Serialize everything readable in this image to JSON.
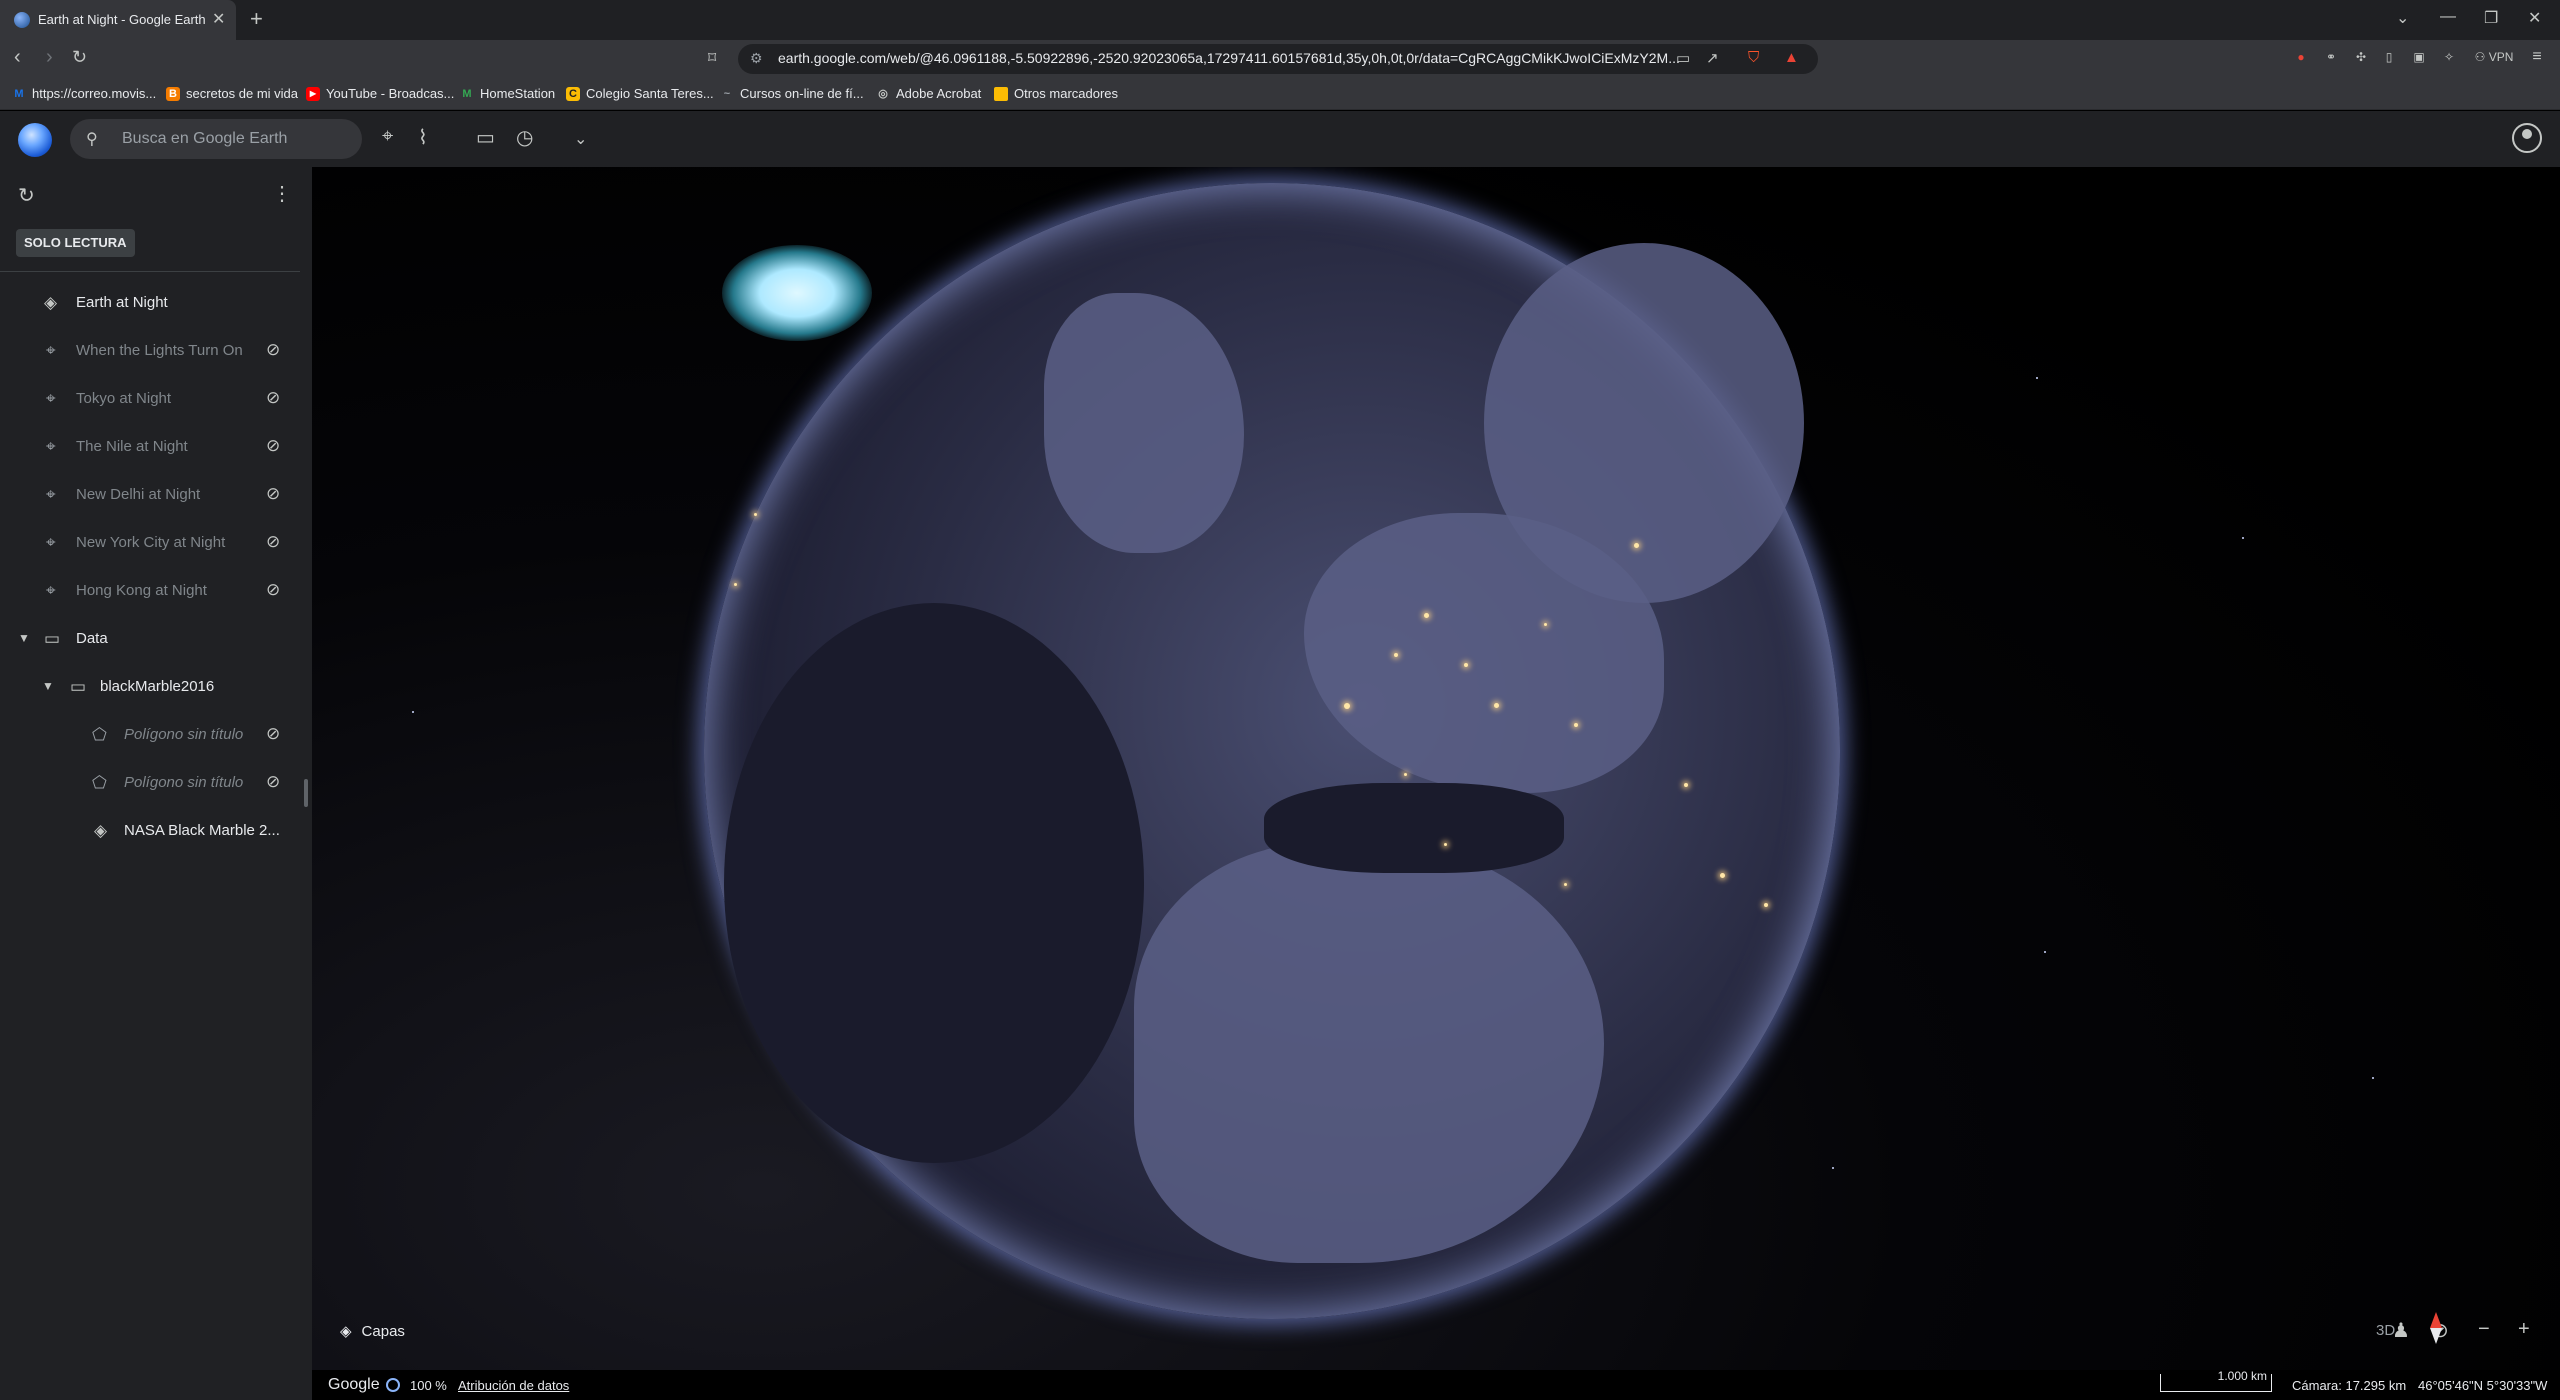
{
  "browser": {
    "tab_title": "Earth at Night - Google Earth",
    "url": "earth.google.com/web/@46.0961188,-5.50922896,-2520.92023065a,17297411.60157681d,35y,0h,0t,0r/data=CgRCAggCMikKJwoICiExMzY2M...",
    "bookmarks": [
      {
        "label": "https://correo.movis...",
        "color": "#1a73e8",
        "glyph": "M"
      },
      {
        "label": "secretos de mi vida",
        "color": "#f57c00",
        "glyph": "B"
      },
      {
        "label": "YouTube - Broadcas...",
        "color": "#ff0000",
        "glyph": "▶"
      },
      {
        "label": "HomeStation",
        "color": "#34a853",
        "glyph": "M"
      },
      {
        "label": "Colegio Santa Teres...",
        "color": "#fbbc04",
        "glyph": "C"
      },
      {
        "label": "Cursos on-line de fí...",
        "color": "#5f6368",
        "glyph": "~"
      },
      {
        "label": "Adobe Acrobat",
        "color": "#5f6368",
        "glyph": "◎"
      },
      {
        "label": "Otros marcadores",
        "color": "#fbbc04",
        "glyph": "▭"
      }
    ],
    "vpn_label": "VPN"
  },
  "earth": {
    "search_placeholder": "Busca en Google Earth",
    "readonly_badge": "SOLO LECTURA",
    "project_title": "Earth at Night",
    "places": [
      "When the Lights Turn On",
      "Tokyo at Night",
      "The Nile at Night",
      "New Delhi at Night",
      "New York City at Night",
      "Hong Kong at Night"
    ],
    "folder_data": "Data",
    "folder_black_marble": "blackMarble2016",
    "polygons": [
      "Polígono sin título",
      "Polígono sin título"
    ],
    "layer_nasa": "NASA Black Marble 2...",
    "layers_button": "Capas",
    "view_3d": "3D"
  },
  "footer": {
    "google": "Google",
    "percent": "100 %",
    "attribution": "Atribución de datos",
    "scale": "1.000 km",
    "camera": "Cámara: 17.295 km",
    "coordinates": "46°05'46\"N 5°30'33\"W"
  }
}
